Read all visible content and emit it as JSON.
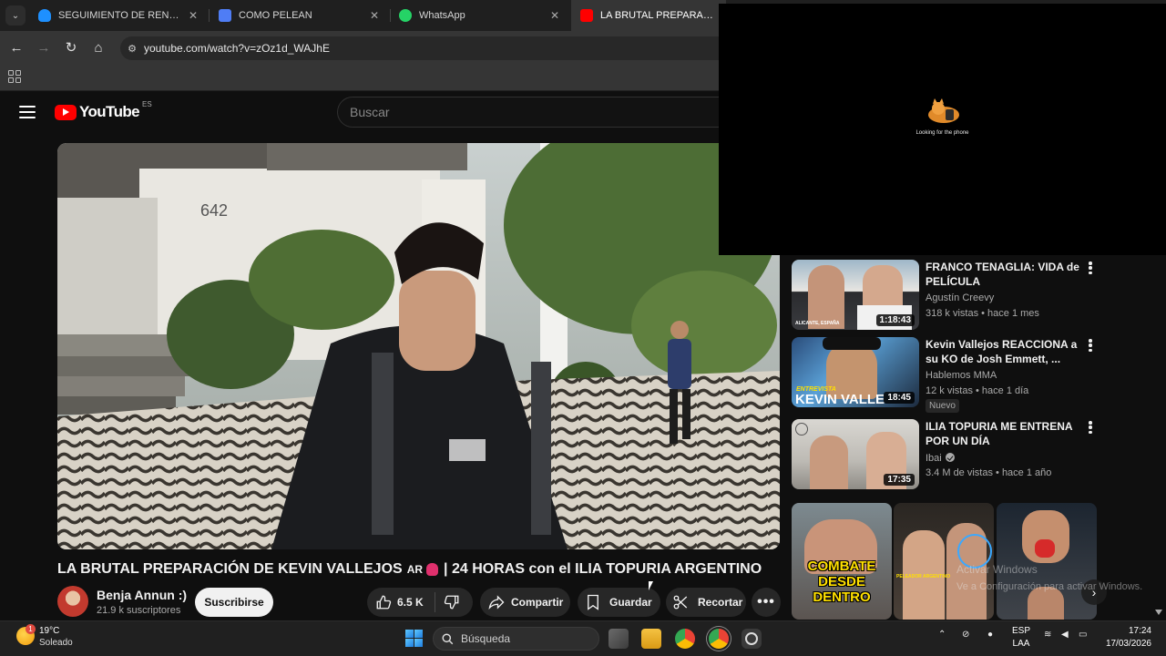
{
  "browser": {
    "tabs": [
      {
        "title": "SEGUIMIENTO DE RENDIMIENT",
        "favicon": "cloud-icon",
        "color": "#1e90ff"
      },
      {
        "title": "COMO PELEAN",
        "favicon": "docs-icon",
        "color": "#4f7df5"
      },
      {
        "title": "WhatsApp",
        "favicon": "whatsapp-icon",
        "color": "#25d366"
      },
      {
        "title": "LA BRUTAL PREPARACIÓN DE",
        "favicon": "youtube-icon",
        "color": "#ff0000"
      }
    ],
    "url": "youtube.com/watch?v=zOz1d_WAJhE"
  },
  "youtube": {
    "logo": "YouTube",
    "region": "ES",
    "search_placeholder": "Buscar"
  },
  "video": {
    "title": "LA BRUTAL PREPARACIÓN DE KEVIN VALLEJOS",
    "title_tag": "AR",
    "title_suffix": "| 24 HORAS con el ILIA TOPURIA ARGENTINO",
    "scene_number": "642",
    "channel": "Benja Annun :)",
    "subscribers": "21.9 k suscriptores",
    "subscribe_label": "Suscribirse",
    "likes": "6.5 K",
    "share_label": "Compartir",
    "save_label": "Guardar",
    "clip_label": "Recortar"
  },
  "overlay": {
    "message": "Looking for the phone"
  },
  "recommendations": [
    {
      "title": "FRANCO TENAGLIA: VIDA de PELÍCULA",
      "channel": "Agustín Creevy",
      "meta": "318 k vistas • hace 1 mes",
      "duration": "1:18:43",
      "thumb_caption": "ALICANTE, ESPAÑA"
    },
    {
      "title": "Kevin Vallejos REACCIONA a su KO de Josh Emmett, ...",
      "channel": "Hablemos MMA",
      "meta": "12 k vistas • hace 1 día",
      "duration": "18:45",
      "badge": "Nuevo",
      "thumb_caption": "ENTREVISTA",
      "thumb_big": "KEVIN VALLE"
    },
    {
      "title": "ILIA TOPURIA ME ENTRENA POR UN DÍA",
      "channel": "Ibai",
      "meta": "3.4 M de vistas • hace 1 año",
      "duration": "17:35"
    }
  ],
  "shelf": {
    "combate_text": "COMBATE DESDE DENTRO",
    "second_caption": "PELEADOR ARGENTINO",
    "watermark_line1": "Activar Windows",
    "watermark_line2": "Ve a Configuración para activar Windows."
  },
  "taskbar": {
    "temperature": "19°C",
    "condition": "Soleado",
    "weather_badge": "1",
    "search_placeholder": "Búsqueda",
    "lang1": "ESP",
    "lang2": "LAA",
    "time": "17:24",
    "date": "17/03/2026"
  },
  "colors": {
    "youtube_red": "#ff0000",
    "background": "#0f0f0f",
    "pill": "#272727"
  }
}
